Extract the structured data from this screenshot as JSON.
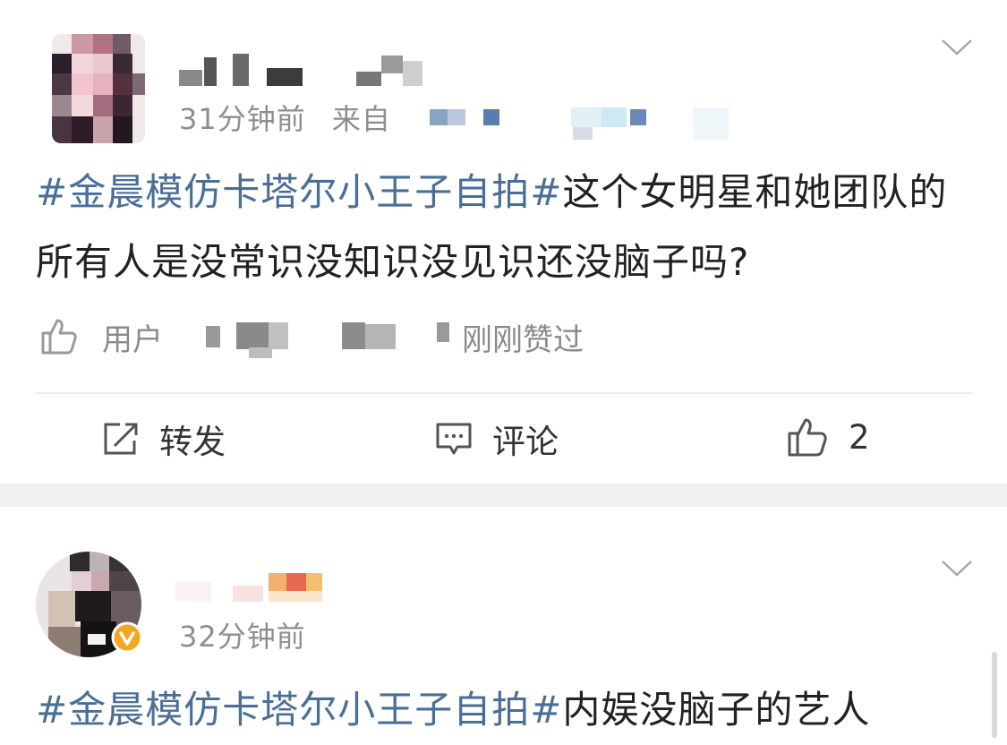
{
  "post1": {
    "time": "31分钟前",
    "source_prefix": "来自",
    "topic": "#金晨模仿卡塔尔小王子自拍#",
    "text": "这个女明星和她团队的所有人是没常识没知识没见识还没脑子吗?",
    "likes_prefix": "用户",
    "likes_suffix": "刚刚赞过",
    "actions": {
      "repost": "转发",
      "comment": "评论",
      "like_count": "2"
    }
  },
  "post2": {
    "time": "32分钟前",
    "topic": "#金晨模仿卡塔尔小王子自拍#",
    "text": "内娱没脑子的艺人"
  },
  "colors": {
    "topic": "#4a6f97",
    "meta": "#8e8e8e",
    "verified_badge": "#f5a623",
    "separator": "#f0f0f0"
  },
  "icons": [
    "chevron-down-icon",
    "thumbs-up-icon",
    "repost-icon",
    "comment-icon",
    "verified-badge-icon"
  ]
}
